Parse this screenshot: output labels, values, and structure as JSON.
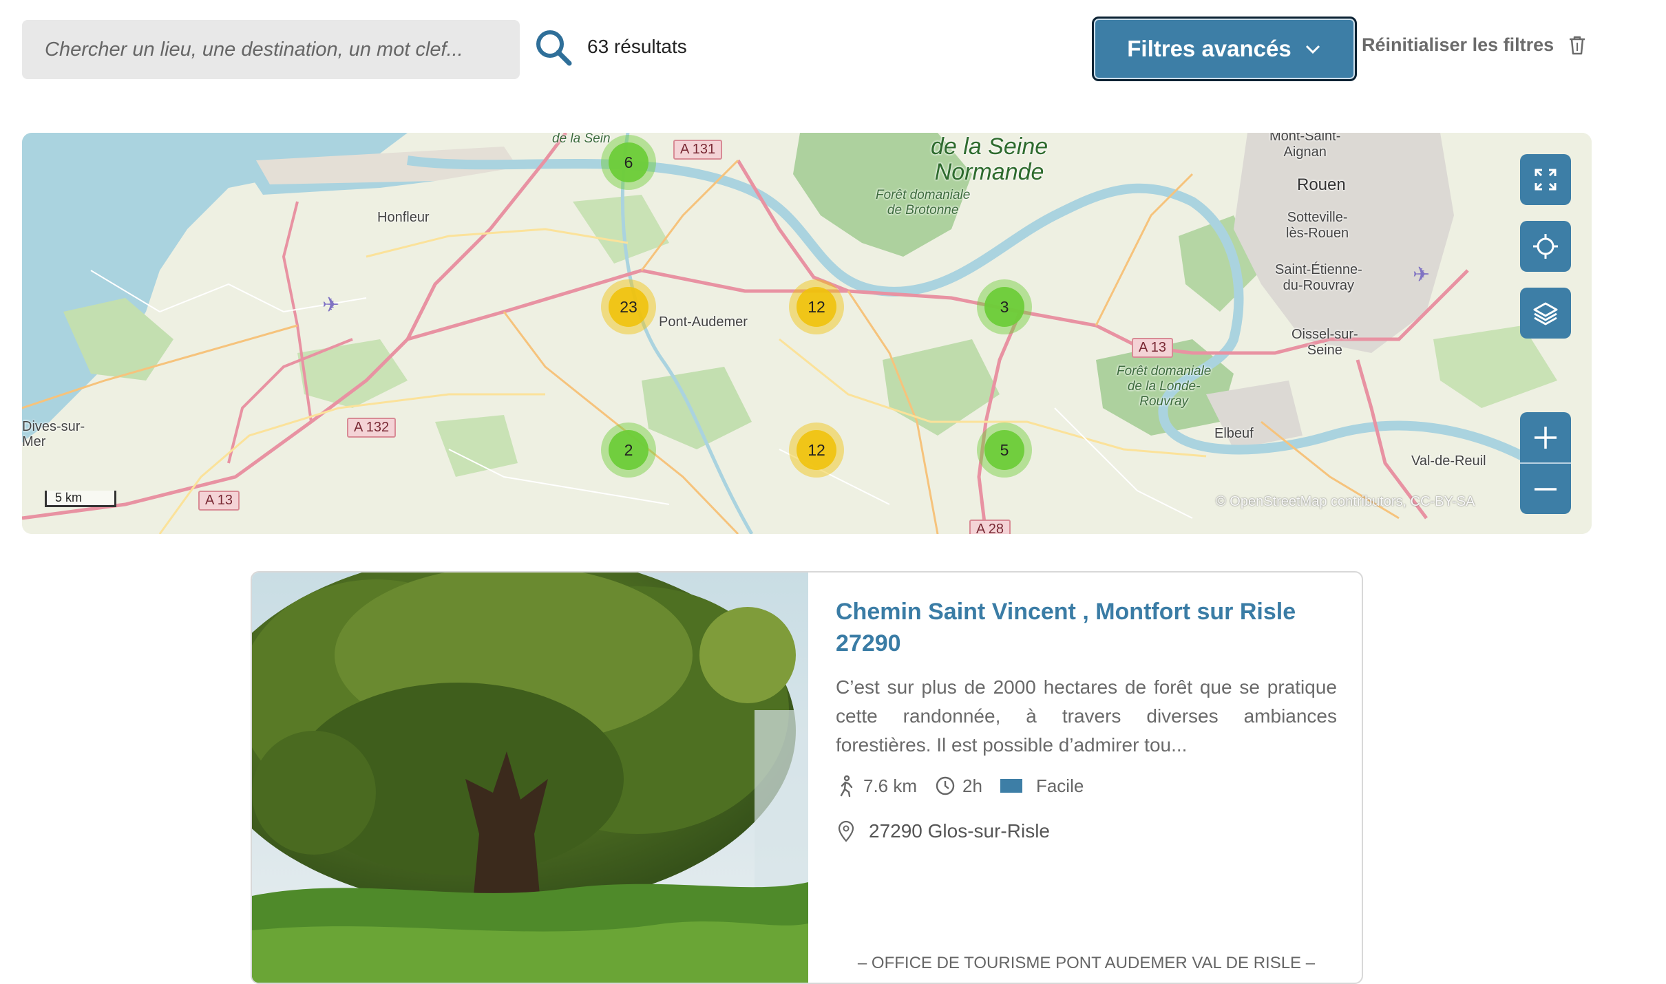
{
  "search": {
    "placeholder": "Chercher un lieu, une destination, un mot clef...",
    "value": "",
    "button_icon": "search-icon"
  },
  "results": {
    "count_label": "63 résultats"
  },
  "filters": {
    "label": "Filtres avancés",
    "icon": "chevron-down-icon"
  },
  "reset": {
    "label": "Réinitialiser les filtres",
    "icon": "trash-icon"
  },
  "map": {
    "labels": {
      "honfleur": "Honfleur",
      "pont_audemer": "Pont-Audemer",
      "dives": "Dives-sur-\nMer",
      "elbeuf": "Elbeuf",
      "val_de_reuil": "Val-de-Reuil",
      "rouen": "Rouen",
      "mont_saint_aignan": "Mont-Saint-\nAignan",
      "sotteville": "Sotteville-\nlès-Rouen",
      "saint_etienne": "Saint-Étienne-\ndu-Rouvray",
      "oissel": "Oissel-sur-\nSeine",
      "seine_normande": "de la Seine\nNormande",
      "brotonne": "Forêt domaniale\nde Brotonne",
      "londe": "Forêt domaniale\nde la Londe-\nRouvray",
      "estuaire": "de la Sein"
    },
    "roads": [
      "A 131",
      "A 132",
      "A 13",
      "A 13",
      "A 28"
    ],
    "clusters": [
      {
        "count": "6",
        "color": "green"
      },
      {
        "count": "23",
        "color": "yellow"
      },
      {
        "count": "12",
        "color": "yellow"
      },
      {
        "count": "3",
        "color": "green"
      },
      {
        "count": "2",
        "color": "green"
      },
      {
        "count": "12",
        "color": "yellow"
      },
      {
        "count": "5",
        "color": "green"
      }
    ],
    "controls": [
      "fullscreen-icon",
      "locate-icon",
      "layers-icon",
      "zoom-in-icon",
      "zoom-out-icon"
    ],
    "scale": "5 km",
    "attribution": "© OpenStreetMap contributors, CC-BY-SA"
  },
  "card": {
    "title": "Chemin Saint Vincent , Montfort sur Risle 27290",
    "description": "C’est sur plus de 2000 hectares de forêt que se pratique cette randonnée, à travers diverses ambiances forestières. Il est possible d’admirer tou...",
    "distance": "7.6 km",
    "duration": "2h",
    "level": "Facile",
    "location": "27290 Glos-sur-Risle",
    "provider": "– OFFICE DE TOURISME PONT AUDEMER VAL DE RISLE –",
    "image": "tree-photo"
  },
  "colors": {
    "accent": "#3d7ea6",
    "title": "#3a7ca5",
    "cluster_green": "#6ecc39",
    "cluster_yellow": "#f0c20c"
  }
}
